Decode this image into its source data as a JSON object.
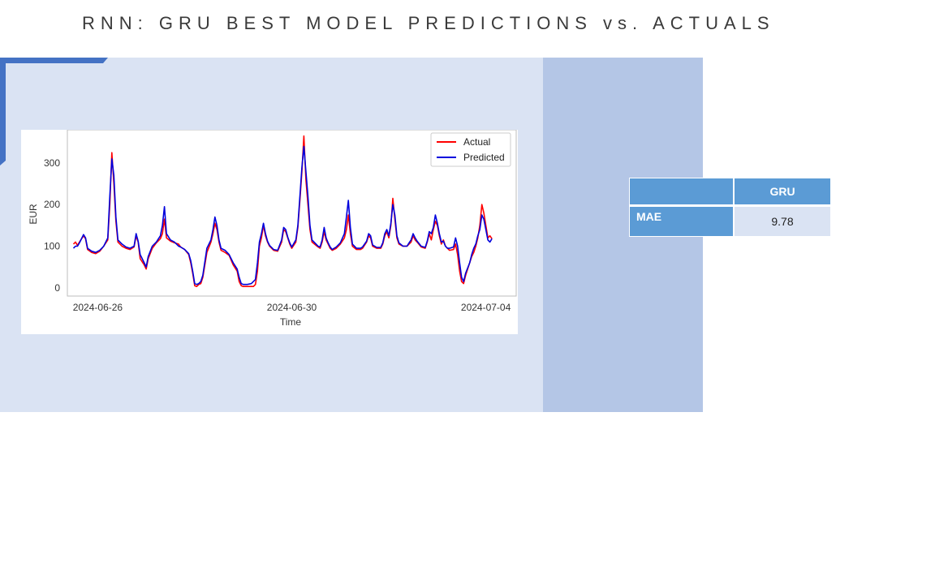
{
  "slide": {
    "title": "RNN: GRU BEST MODEL PREDICTIONS vs. ACTUALS"
  },
  "colors": {
    "left_panel": "#dae3f3",
    "right_panel": "#b4c6e6",
    "accent": "#4472c4",
    "table_header": "#5b9bd5",
    "table_cell": "#dae3f3"
  },
  "metrics_table": {
    "header": [
      "",
      "GRU"
    ],
    "rows": [
      {
        "label": "MAE",
        "value": "9.78"
      }
    ]
  },
  "chart_data": {
    "type": "line",
    "xlabel": "Time",
    "ylabel": "EUR",
    "x_start": "2024-06-25 12:00",
    "x_step_hours": 1,
    "xlim": [
      "2024-06-25 09:00",
      "2024-07-04 15:00"
    ],
    "x_ticks": [
      "2024-06-26",
      "2024-06-30",
      "2024-07-04"
    ],
    "y_ticks": [
      0,
      100,
      200,
      300
    ],
    "ylim": [
      -20,
      380
    ],
    "grid": false,
    "legend": "top-right",
    "series": [
      {
        "name": "Actual",
        "color": "#ff0000",
        "anchors": [
          [
            0,
            105
          ],
          [
            1,
            110
          ],
          [
            2,
            102
          ],
          [
            3,
            110
          ],
          [
            5,
            125
          ],
          [
            6,
            118
          ],
          [
            7,
            92
          ],
          [
            9,
            85
          ],
          [
            11,
            82
          ],
          [
            13,
            88
          ],
          [
            15,
            100
          ],
          [
            17,
            115
          ],
          [
            18,
            200
          ],
          [
            19,
            325
          ],
          [
            20,
            250
          ],
          [
            21,
            160
          ],
          [
            22,
            110
          ],
          [
            24,
            100
          ],
          [
            26,
            95
          ],
          [
            28,
            92
          ],
          [
            30,
            98
          ],
          [
            31,
            125
          ],
          [
            32,
            110
          ],
          [
            33,
            70
          ],
          [
            35,
            55
          ],
          [
            36,
            45
          ],
          [
            37,
            70
          ],
          [
            39,
            95
          ],
          [
            41,
            108
          ],
          [
            43,
            118
          ],
          [
            44,
            130
          ],
          [
            45,
            165
          ],
          [
            46,
            120
          ],
          [
            48,
            112
          ],
          [
            50,
            108
          ],
          [
            52,
            105
          ],
          [
            53,
            98
          ],
          [
            55,
            92
          ],
          [
            57,
            80
          ],
          [
            58,
            60
          ],
          [
            59,
            35
          ],
          [
            60,
            5
          ],
          [
            61,
            3
          ],
          [
            62,
            8
          ],
          [
            63,
            10
          ],
          [
            64,
            25
          ],
          [
            66,
            85
          ],
          [
            68,
            110
          ],
          [
            69,
            130
          ],
          [
            70,
            155
          ],
          [
            71,
            140
          ],
          [
            72,
            110
          ],
          [
            73,
            90
          ],
          [
            75,
            85
          ],
          [
            77,
            78
          ],
          [
            79,
            55
          ],
          [
            81,
            40
          ],
          [
            82,
            15
          ],
          [
            83,
            5
          ],
          [
            84,
            3
          ],
          [
            86,
            3
          ],
          [
            89,
            3
          ],
          [
            90,
            8
          ],
          [
            91,
            40
          ],
          [
            92,
            100
          ],
          [
            93,
            120
          ],
          [
            94,
            150
          ],
          [
            95,
            125
          ],
          [
            96,
            110
          ],
          [
            97,
            100
          ],
          [
            99,
            90
          ],
          [
            101,
            88
          ],
          [
            103,
            110
          ],
          [
            104,
            140
          ],
          [
            105,
            135
          ],
          [
            106,
            120
          ],
          [
            107,
            105
          ],
          [
            108,
            95
          ],
          [
            110,
            110
          ],
          [
            111,
            145
          ],
          [
            112,
            210
          ],
          [
            113,
            280
          ],
          [
            114,
            365
          ],
          [
            115,
            260
          ],
          [
            116,
            200
          ],
          [
            117,
            140
          ],
          [
            118,
            110
          ],
          [
            120,
            102
          ],
          [
            121,
            98
          ],
          [
            122,
            95
          ],
          [
            123,
            110
          ],
          [
            124,
            135
          ],
          [
            125,
            115
          ],
          [
            126,
            105
          ],
          [
            127,
            95
          ],
          [
            128,
            90
          ],
          [
            130,
            95
          ],
          [
            132,
            105
          ],
          [
            134,
            120
          ],
          [
            135,
            140
          ],
          [
            136,
            175
          ],
          [
            137,
            130
          ],
          [
            138,
            100
          ],
          [
            140,
            92
          ],
          [
            142,
            92
          ],
          [
            143,
            95
          ],
          [
            145,
            110
          ],
          [
            146,
            125
          ],
          [
            147,
            120
          ],
          [
            148,
            100
          ],
          [
            150,
            95
          ],
          [
            152,
            95
          ],
          [
            153,
            105
          ],
          [
            154,
            125
          ],
          [
            155,
            135
          ],
          [
            156,
            120
          ],
          [
            157,
            150
          ],
          [
            158,
            215
          ],
          [
            159,
            165
          ],
          [
            160,
            120
          ],
          [
            161,
            105
          ],
          [
            163,
            100
          ],
          [
            165,
            100
          ],
          [
            166,
            105
          ],
          [
            167,
            110
          ],
          [
            168,
            125
          ],
          [
            169,
            115
          ],
          [
            170,
            110
          ],
          [
            172,
            98
          ],
          [
            174,
            95
          ],
          [
            175,
            110
          ],
          [
            176,
            130
          ],
          [
            177,
            115
          ],
          [
            178,
            140
          ],
          [
            179,
            160
          ],
          [
            180,
            150
          ],
          [
            181,
            125
          ],
          [
            182,
            105
          ],
          [
            183,
            115
          ],
          [
            184,
            100
          ],
          [
            185,
            95
          ],
          [
            186,
            90
          ],
          [
            188,
            92
          ],
          [
            189,
            105
          ],
          [
            190,
            80
          ],
          [
            191,
            40
          ],
          [
            192,
            15
          ],
          [
            193,
            10
          ],
          [
            194,
            30
          ],
          [
            196,
            60
          ],
          [
            197,
            75
          ],
          [
            198,
            85
          ],
          [
            199,
            100
          ],
          [
            200,
            120
          ],
          [
            201,
            150
          ],
          [
            202,
            200
          ],
          [
            203,
            180
          ],
          [
            204,
            150
          ],
          [
            205,
            120
          ],
          [
            206,
            125
          ],
          [
            207,
            118
          ]
        ]
      },
      {
        "name": "Predicted",
        "color": "#0000dd",
        "anchors": [
          [
            0,
            95
          ],
          [
            1,
            100
          ],
          [
            2,
            100
          ],
          [
            3,
            108
          ],
          [
            4,
            118
          ],
          [
            5,
            128
          ],
          [
            6,
            120
          ],
          [
            7,
            95
          ],
          [
            9,
            88
          ],
          [
            11,
            85
          ],
          [
            13,
            90
          ],
          [
            15,
            100
          ],
          [
            17,
            120
          ],
          [
            18,
            220
          ],
          [
            19,
            310
          ],
          [
            20,
            270
          ],
          [
            21,
            170
          ],
          [
            22,
            115
          ],
          [
            24,
            105
          ],
          [
            26,
            98
          ],
          [
            28,
            95
          ],
          [
            30,
            100
          ],
          [
            31,
            130
          ],
          [
            32,
            112
          ],
          [
            33,
            80
          ],
          [
            35,
            60
          ],
          [
            36,
            50
          ],
          [
            37,
            75
          ],
          [
            39,
            100
          ],
          [
            41,
            110
          ],
          [
            43,
            125
          ],
          [
            44,
            150
          ],
          [
            45,
            195
          ],
          [
            46,
            130
          ],
          [
            48,
            115
          ],
          [
            50,
            110
          ],
          [
            52,
            100
          ],
          [
            53,
            98
          ],
          [
            55,
            92
          ],
          [
            57,
            82
          ],
          [
            58,
            65
          ],
          [
            59,
            40
          ],
          [
            60,
            10
          ],
          [
            61,
            8
          ],
          [
            62,
            10
          ],
          [
            63,
            15
          ],
          [
            64,
            30
          ],
          [
            66,
            95
          ],
          [
            68,
            115
          ],
          [
            69,
            140
          ],
          [
            70,
            170
          ],
          [
            71,
            150
          ],
          [
            72,
            115
          ],
          [
            73,
            95
          ],
          [
            75,
            90
          ],
          [
            77,
            80
          ],
          [
            79,
            60
          ],
          [
            81,
            45
          ],
          [
            82,
            25
          ],
          [
            83,
            10
          ],
          [
            84,
            8
          ],
          [
            86,
            8
          ],
          [
            88,
            10
          ],
          [
            90,
            20
          ],
          [
            91,
            60
          ],
          [
            92,
            110
          ],
          [
            93,
            130
          ],
          [
            94,
            155
          ],
          [
            95,
            130
          ],
          [
            96,
            112
          ],
          [
            97,
            102
          ],
          [
            99,
            92
          ],
          [
            101,
            90
          ],
          [
            103,
            115
          ],
          [
            104,
            145
          ],
          [
            105,
            140
          ],
          [
            106,
            122
          ],
          [
            107,
            108
          ],
          [
            108,
            98
          ],
          [
            110,
            115
          ],
          [
            111,
            150
          ],
          [
            112,
            220
          ],
          [
            113,
            290
          ],
          [
            114,
            340
          ],
          [
            115,
            280
          ],
          [
            116,
            220
          ],
          [
            117,
            150
          ],
          [
            118,
            115
          ],
          [
            120,
            105
          ],
          [
            121,
            100
          ],
          [
            122,
            98
          ],
          [
            123,
            115
          ],
          [
            124,
            145
          ],
          [
            125,
            120
          ],
          [
            126,
            108
          ],
          [
            127,
            98
          ],
          [
            128,
            92
          ],
          [
            130,
            98
          ],
          [
            132,
            108
          ],
          [
            134,
            130
          ],
          [
            135,
            170
          ],
          [
            136,
            210
          ],
          [
            137,
            145
          ],
          [
            138,
            105
          ],
          [
            140,
            95
          ],
          [
            142,
            95
          ],
          [
            143,
            98
          ],
          [
            145,
            112
          ],
          [
            146,
            130
          ],
          [
            147,
            125
          ],
          [
            148,
            103
          ],
          [
            150,
            97
          ],
          [
            152,
            97
          ],
          [
            153,
            108
          ],
          [
            154,
            130
          ],
          [
            155,
            140
          ],
          [
            156,
            125
          ],
          [
            157,
            155
          ],
          [
            158,
            200
          ],
          [
            159,
            175
          ],
          [
            160,
            125
          ],
          [
            161,
            108
          ],
          [
            163,
            100
          ],
          [
            165,
            100
          ],
          [
            166,
            108
          ],
          [
            167,
            115
          ],
          [
            168,
            130
          ],
          [
            169,
            120
          ],
          [
            170,
            112
          ],
          [
            172,
            100
          ],
          [
            174,
            97
          ],
          [
            175,
            112
          ],
          [
            176,
            135
          ],
          [
            177,
            130
          ],
          [
            178,
            145
          ],
          [
            179,
            175
          ],
          [
            180,
            155
          ],
          [
            181,
            130
          ],
          [
            182,
            110
          ],
          [
            183,
            112
          ],
          [
            184,
            100
          ],
          [
            185,
            95
          ],
          [
            186,
            95
          ],
          [
            188,
            98
          ],
          [
            189,
            120
          ],
          [
            190,
            100
          ],
          [
            191,
            60
          ],
          [
            192,
            25
          ],
          [
            193,
            15
          ],
          [
            194,
            35
          ],
          [
            196,
            60
          ],
          [
            197,
            80
          ],
          [
            198,
            95
          ],
          [
            199,
            105
          ],
          [
            200,
            125
          ],
          [
            201,
            140
          ],
          [
            202,
            175
          ],
          [
            203,
            165
          ],
          [
            204,
            140
          ],
          [
            205,
            115
          ],
          [
            206,
            110
          ],
          [
            207,
            118
          ]
        ]
      }
    ]
  }
}
